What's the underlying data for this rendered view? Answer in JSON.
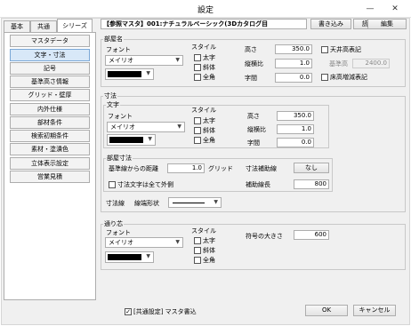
{
  "window": {
    "title": "設定",
    "controls": {
      "minimize": "—",
      "close": "✕"
    }
  },
  "tabs": [
    "基本",
    "共通",
    "シリーズ"
  ],
  "sidebar": {
    "items": [
      "マスタデータ",
      "文字・寸法",
      "記号",
      "基準高さ情報",
      "グリッド・壁厚",
      "内外仕様",
      "部材条件",
      "検索初期条件",
      "素材・塗潰色",
      "立体表示設定",
      "営業見積"
    ]
  },
  "header": {
    "info": "【参照マスタ】001:ナチュラルベーシック(3Dカタログ目",
    "write": "書き込み",
    "read": "読み込み",
    "edit": "編集"
  },
  "room_name": {
    "title": "部屋名",
    "font_label": "フォント",
    "font_value": "メイリオ",
    "style_label": "スタイル",
    "styles": [
      "太字",
      "斜体",
      "全角"
    ],
    "height_label": "高さ",
    "height_value": "350.0",
    "aspect_label": "縦横比",
    "aspect_value": "1.0",
    "spacing_label": "字間",
    "spacing_value": "0.0",
    "ceiling_label": "天井高表記",
    "base_height_label": "基準高",
    "base_height_value": "2400.0",
    "floor_label": "床高増減表記"
  },
  "dimension": {
    "title": "寸法",
    "text_title": "文字",
    "font_label": "フォント",
    "font_value": "メイリオ",
    "style_label": "スタイル",
    "styles": [
      "太字",
      "斜体",
      "全角"
    ],
    "height_label": "高さ",
    "height_value": "350.0",
    "aspect_label": "縦横比",
    "aspect_value": "1.0",
    "spacing_label": "字間",
    "spacing_value": "0.0",
    "room_dim_title": "部屋寸法",
    "base_distance_label": "基準線からの距離",
    "base_distance_value": "1.0",
    "grid_label": "グリッド",
    "aux_line_label": "寸法補助線",
    "aux_line_value": "なし",
    "outside_label": "寸法文字は全て外側",
    "aux_length_label": "補助線長",
    "aux_length_value": "800",
    "dim_line_label": "寸法線",
    "end_shape_label": "線端形状"
  },
  "reference": {
    "title": "通り芯",
    "font_label": "フォント",
    "font_value": "メイリオ",
    "style_label": "スタイル",
    "styles": [
      "太字",
      "斜体",
      "全角"
    ],
    "symbol_size_label": "符号の大きさ",
    "symbol_size_value": "600"
  },
  "footer": {
    "master_write_label": "[共通設定] マスタ書込",
    "ok": "OK",
    "cancel": "キャンセル"
  }
}
